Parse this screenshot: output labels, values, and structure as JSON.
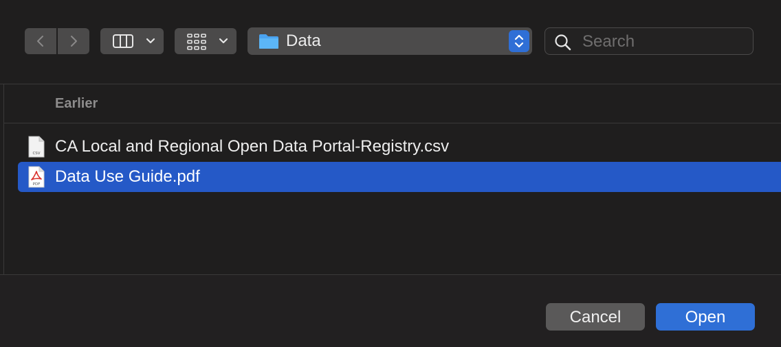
{
  "toolbar": {
    "path_label": "Data",
    "search_placeholder": "Search"
  },
  "icons": {
    "back": "chevron-left-icon",
    "forward": "chevron-right-icon",
    "column_view": "columns-icon",
    "icon_view": "grid-icon",
    "folder": "folder-icon",
    "search": "search-icon",
    "csv": "csv-file-icon",
    "pdf": "pdf-file-icon"
  },
  "browser": {
    "section_header": "Earlier",
    "files": [
      {
        "name": "CA Local and Regional Open Data Portal-Registry.csv",
        "type_badge": "CSV",
        "selected": false
      },
      {
        "name": "Data Use Guide.pdf",
        "type_badge": "PDF",
        "selected": true
      }
    ]
  },
  "footer": {
    "cancel_label": "Cancel",
    "open_label": "Open"
  },
  "colors": {
    "accent": "#2f6fd6",
    "selection": "#2559c7",
    "folder": "#4aa3f0",
    "pdf_red": "#d9302c"
  }
}
